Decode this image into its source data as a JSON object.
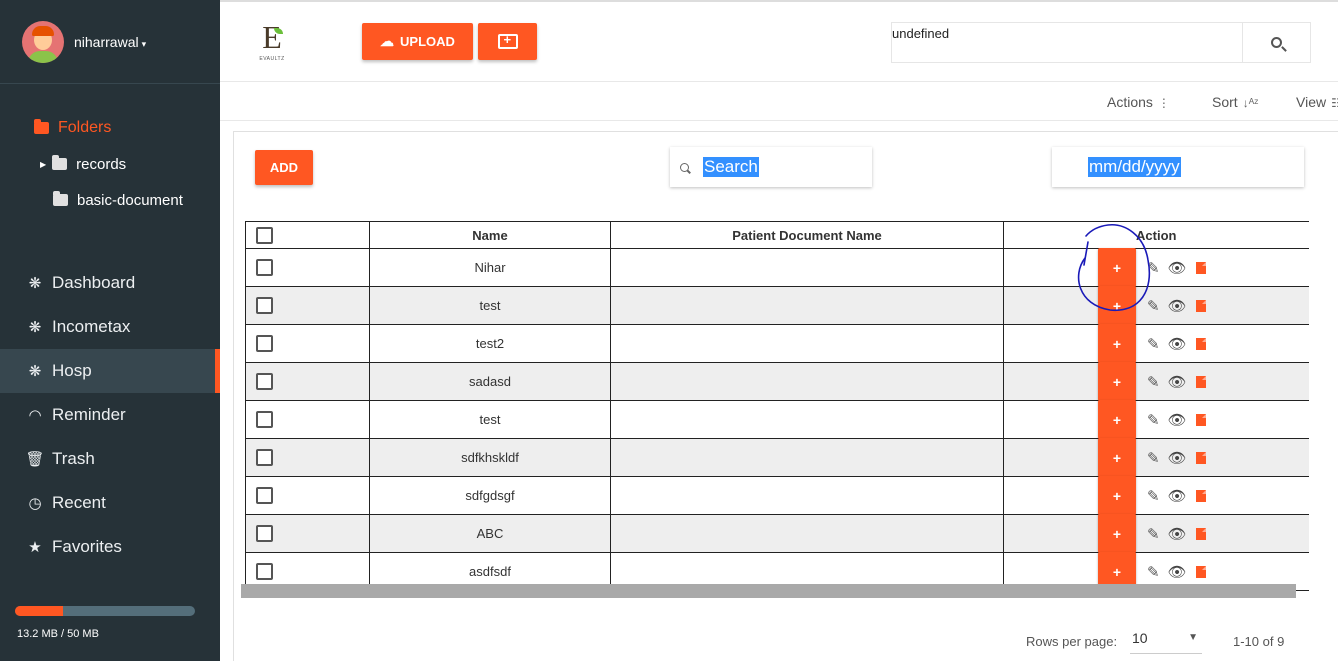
{
  "user": {
    "name": "niharrawal",
    "caret": "▾"
  },
  "sidebar": {
    "folders_title": "Folders",
    "folders": [
      {
        "label": "records"
      },
      {
        "label": "basic-document"
      }
    ],
    "nav": [
      {
        "label": "Dashboard",
        "icon": "asterisk-icon",
        "glyph": "❋"
      },
      {
        "label": "Incometax",
        "icon": "asterisk-icon",
        "glyph": "❋"
      },
      {
        "label": "Hosp",
        "icon": "asterisk-icon",
        "glyph": "❋"
      },
      {
        "label": "Reminder",
        "icon": "gauge-icon",
        "glyph": "◠"
      },
      {
        "label": "Trash",
        "icon": "trash-icon",
        "glyph": "🗑"
      },
      {
        "label": "Recent",
        "icon": "clock-icon",
        "glyph": "◷"
      },
      {
        "label": "Favorites",
        "icon": "star-icon",
        "glyph": "★"
      }
    ],
    "storage": {
      "text": "13.2 MB / 50 MB",
      "fraction": 0.264
    }
  },
  "header": {
    "logo_letter": "E",
    "logo_text": "EVAULTZ",
    "upload_label": "UPLOAD",
    "search_value": "undefined"
  },
  "toolbar": {
    "actions": "Actions",
    "sort": "Sort",
    "view": "View"
  },
  "content": {
    "add_label": "ADD",
    "search_placeholder": "Search",
    "date_placeholder": "mm/dd/yyyy"
  },
  "table": {
    "columns": [
      "Name",
      "Patient Document Name",
      "Action"
    ],
    "action_plus": "+",
    "rows": [
      {
        "name": "Nihar",
        "patient_doc": ""
      },
      {
        "name": "test",
        "patient_doc": ""
      },
      {
        "name": "test2",
        "patient_doc": ""
      },
      {
        "name": "sadasd",
        "patient_doc": ""
      },
      {
        "name": "test",
        "patient_doc": ""
      },
      {
        "name": "sdfkhskldf",
        "patient_doc": ""
      },
      {
        "name": "sdfgdsgf",
        "patient_doc": ""
      },
      {
        "name": "ABC",
        "patient_doc": ""
      },
      {
        "name": "asdfsdf",
        "patient_doc": ""
      }
    ]
  },
  "pagination": {
    "rows_per_page_label": "Rows per page:",
    "rows_per_page": "10",
    "range": "1-10 of 9"
  },
  "colors": {
    "accent": "#ff5722",
    "sidebar_bg": "#263238",
    "annotation": "#1a1ab8"
  }
}
